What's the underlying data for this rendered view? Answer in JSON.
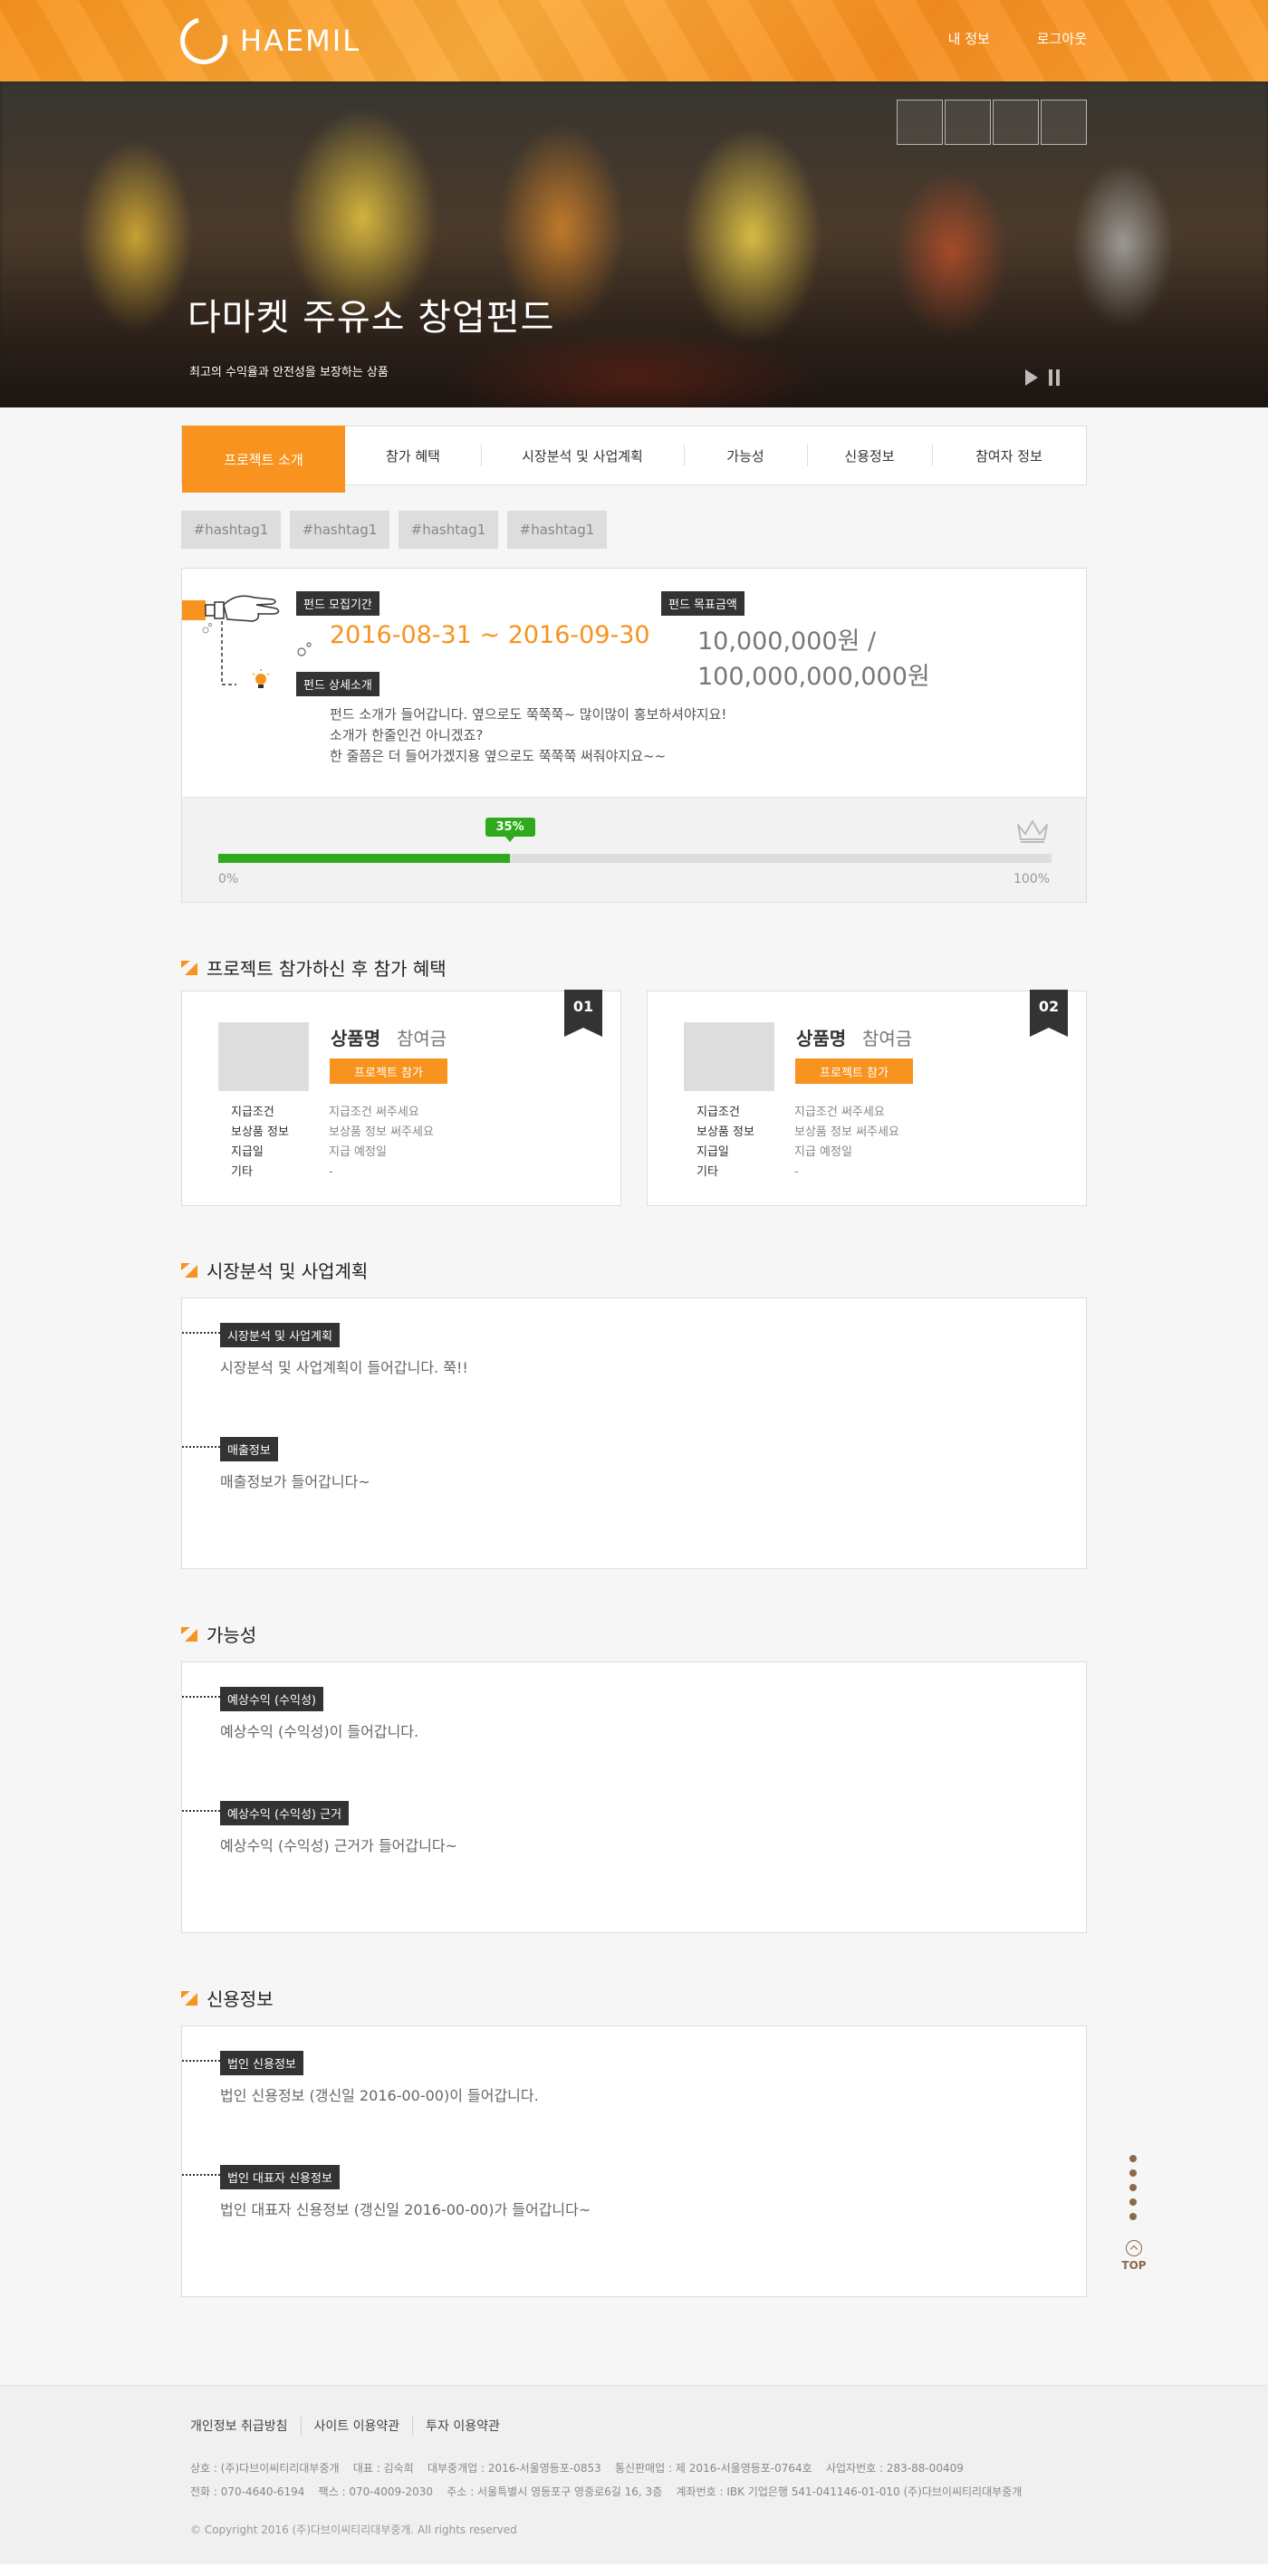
{
  "header": {
    "logo_text": "HAEMIL",
    "nav": [
      "내 정보",
      "로그아웃"
    ]
  },
  "hero": {
    "title": "다마켓 주유소 창업펀드",
    "subtitle": "최고의 수익율과 안전성을 보장하는 상품",
    "thumb_count": 4
  },
  "tabs": [
    "프로젝트 소개",
    "참가 혜택",
    "시장분석 및 사업계획",
    "가능성",
    "신용정보",
    "참여자 정보"
  ],
  "active_tab": 0,
  "hashtags": [
    "#hashtag1",
    "#hashtag1",
    "#hashtag1",
    "#hashtag1"
  ],
  "fund": {
    "period_label": "펀드 모집기간",
    "period": "2016-08-31 ~ 2016-09-30",
    "goal_label": "펀드 목표금액",
    "goal": "10,000,000원 / 100,000,000,000원",
    "desc_label": "펀드 상세소개",
    "desc": [
      "펀드 소개가 들어갑니다. 옆으로도 쭉쭉쭉~ 많이많이 홍보하셔야지요!",
      "소개가 한줄인건 아니겠죠?",
      "한 줄쯤은 더 들어가겠지용 옆으로도 쭉쭉쭉 써줘야지요~~"
    ],
    "progress_label": "35%",
    "progress": 0.35,
    "progress_min": "0%",
    "progress_max": "100%"
  },
  "benefits": {
    "heading": "프로젝트 참가하신 후 참가 혜택",
    "cards": [
      {
        "num": "01",
        "name": "상품명",
        "amount": "참여금",
        "button": "프로젝트 참가",
        "rows": [
          {
            "k": "지급조건",
            "v": "지급조건 써주세요"
          },
          {
            "k": "보상품 정보",
            "v": "보상품 정보 써주세요"
          },
          {
            "k": "지급일",
            "v": "지급 예정일"
          },
          {
            "k": "기타",
            "v": "-"
          }
        ]
      },
      {
        "num": "02",
        "name": "상품명",
        "amount": "참여금",
        "button": "프로젝트 참가",
        "rows": [
          {
            "k": "지급조건",
            "v": "지급조건 써주세요"
          },
          {
            "k": "보상품 정보",
            "v": "보상품 정보 써주세요"
          },
          {
            "k": "지급일",
            "v": "지급 예정일"
          },
          {
            "k": "기타",
            "v": "-"
          }
        ]
      }
    ]
  },
  "sections": [
    {
      "heading": "시장분석 및 사업계획",
      "items": [
        {
          "label": "시장분석 및 사업계획",
          "text": "시장분석 및 사업계획이 들어갑니다. 쭉!!"
        },
        {
          "label": "매출정보",
          "text": "매출정보가 들어갑니다~"
        }
      ]
    },
    {
      "heading": "가능성",
      "items": [
        {
          "label": "예상수익 (수익성)",
          "text": "예상수익 (수익성)이 들어갑니다."
        },
        {
          "label": "예상수익 (수익성) 근거",
          "text": "예상수익 (수익성) 근거가 들어갑니다~"
        }
      ]
    },
    {
      "heading": "신용정보",
      "items": [
        {
          "label": "법인 신용정보",
          "text": "법인 신용정보 (갱신일 2016-00-00)이 들어갑니다."
        },
        {
          "label": "법인 대표자 신용정보",
          "text": "법인 대표자 신용정보 (갱신일 2016-00-00)가 들어갑니다~"
        }
      ]
    }
  ],
  "side": {
    "dot_count": 5,
    "top_label": "TOP"
  },
  "footer": {
    "links": [
      "개인정보 취급방침",
      "사이트 이용약관",
      "투자 이용약관"
    ],
    "info_lines": [
      "상호 : (주)다브이씨티리대부중개    대표 : 김숙희    대부중개업 : 2016-서울영등포-0853    통신판매업 : 제 2016-서울영등포-0764호    사업자번호 : 283-88-00409",
      "전화 : 070-4640-6194    팩스 : 070-4009-2030    주소 : 서울특별시 영등포구 영중로6길 16, 3층    계좌번호 : IBK 기업은행 541-041146-01-010 (주)다브이씨티리대부중개"
    ],
    "copyright": "© Copyright 2016 (주)다브이씨티리대부중개. All rights reserved"
  },
  "colors": {
    "accent": "#f7931e",
    "progress": "#2eaa1c",
    "dark_label": "#333333"
  }
}
